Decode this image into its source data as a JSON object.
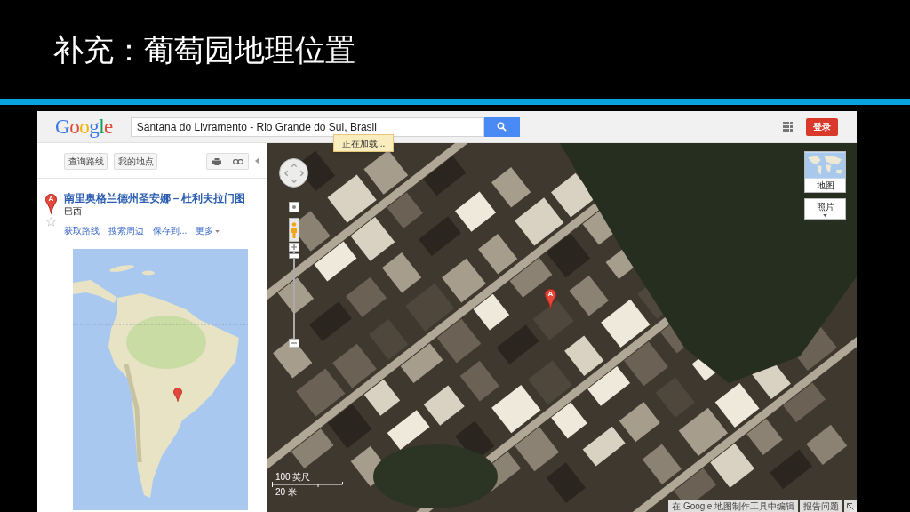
{
  "slide": {
    "title": "补充：葡萄园地理位置"
  },
  "maps_header": {
    "logo": "Google",
    "search": {
      "value": "Santana do Livramento - Rio Grande do Sul, Brasil"
    },
    "sign_in_button": "登录"
  },
  "loading_notice": "正在加载...",
  "left_panel": {
    "buttons": [
      "查询路线",
      "我的地点"
    ],
    "place": {
      "marker_label": "A",
      "title": "南里奥格兰德州圣安娜－杜利夫拉门图",
      "subtitle": "巴西",
      "saved": false
    },
    "actions": [
      {
        "label": "获取路线",
        "kind": "link"
      },
      {
        "label": "搜索周边",
        "kind": "link"
      },
      {
        "label": "保存到...",
        "kind": "link"
      },
      {
        "label": "更多",
        "kind": "menu"
      }
    ]
  },
  "map": {
    "marker_label": "A",
    "zoom_slider": {
      "level": 0.98
    },
    "map_types": [
      {
        "label": "地图",
        "kind": "thumbnail"
      },
      {
        "label": "照片",
        "kind": "dropdown"
      }
    ],
    "scale": {
      "imperial": "100 英尺",
      "metric": "20 米"
    },
    "footer_links": [
      "在 Google 地图制作工具中编辑",
      "报告问题"
    ]
  }
}
